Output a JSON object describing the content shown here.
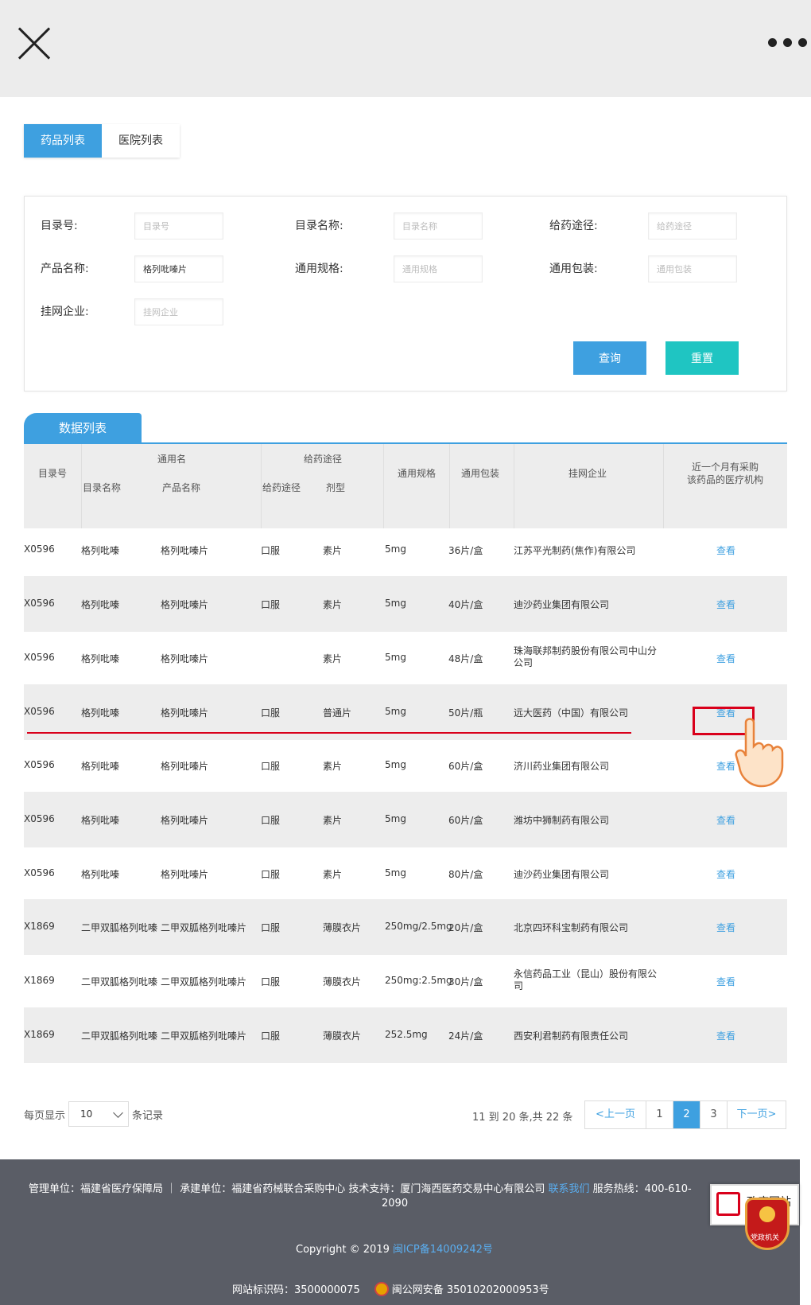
{
  "topbar": {
    "close_icon": "close-icon",
    "more_icon": "more-dots-icon"
  },
  "tabs": {
    "drug_list": "药品列表",
    "hospital_list": "医院列表"
  },
  "filter": {
    "catalog_no_label": "目录号:",
    "catalog_no_placeholder": "目录号",
    "catalog_name_label": "目录名称:",
    "catalog_name_placeholder": "目录名称",
    "route_label": "给药途径:",
    "route_placeholder": "给药途径",
    "product_name_label": "产品名称:",
    "product_name_value": "格列吡嗪片",
    "spec_label": "通用规格:",
    "spec_placeholder": "通用规格",
    "package_label": "通用包装:",
    "package_placeholder": "通用包装",
    "company_label": "挂网企业:",
    "company_placeholder": "挂网企业",
    "query_button": "查询",
    "reset_button": "重置"
  },
  "data_tab": "数据列表",
  "table": {
    "headers": {
      "catalog_no": "目录号",
      "generic_name": "通用名",
      "catalog_name": "目录名称",
      "product_name": "产品名称",
      "route_group": "给药途径",
      "route": "给药途径",
      "dosage_form": "剂型",
      "spec": "通用规格",
      "package": "通用包装",
      "company": "挂网企业",
      "recent_line1": "近一个月有采购",
      "recent_line2": "该药品的医疗机构"
    },
    "rows": [
      {
        "no": "X0596",
        "catalog": "格列吡嗪",
        "product": "格列吡嗪片",
        "route": "口服",
        "form": "素片",
        "spec": "5mg",
        "pack": "36片/盒",
        "company": "江苏平光制药(焦作)有限公司",
        "view": "查看"
      },
      {
        "no": "X0596",
        "catalog": "格列吡嗪",
        "product": "格列吡嗪片",
        "route": "口服",
        "form": "素片",
        "spec": "5mg",
        "pack": "40片/盒",
        "company": "迪沙药业集团有限公司",
        "view": "查看"
      },
      {
        "no": "X0596",
        "catalog": "格列吡嗪",
        "product": "格列吡嗪片",
        "route": "",
        "form": "素片",
        "spec": "5mg",
        "pack": "48片/盒",
        "company": "珠海联邦制药股份有限公司中山分公司",
        "view": "查看"
      },
      {
        "no": "X0596",
        "catalog": "格列吡嗪",
        "product": "格列吡嗪片",
        "route": "口服",
        "form": "普通片",
        "spec": "5mg",
        "pack": "50片/瓶",
        "company": "远大医药（中国）有限公司",
        "view": "查看"
      },
      {
        "no": "X0596",
        "catalog": "格列吡嗪",
        "product": "格列吡嗪片",
        "route": "口服",
        "form": "素片",
        "spec": "5mg",
        "pack": "60片/盒",
        "company": "济川药业集团有限公司",
        "view": "查看"
      },
      {
        "no": "X0596",
        "catalog": "格列吡嗪",
        "product": "格列吡嗪片",
        "route": "口服",
        "form": "素片",
        "spec": "5mg",
        "pack": "60片/盒",
        "company": "潍坊中狮制药有限公司",
        "view": "查看"
      },
      {
        "no": "X0596",
        "catalog": "格列吡嗪",
        "product": "格列吡嗪片",
        "route": "口服",
        "form": "素片",
        "spec": "5mg",
        "pack": "80片/盒",
        "company": "迪沙药业集团有限公司",
        "view": "查看"
      },
      {
        "no": "X1869",
        "catalog": "二甲双胍格列吡嗪",
        "product": "二甲双胍格列吡嗪片",
        "route": "口服",
        "form": "薄膜衣片",
        "spec": "250mg/2.5mg",
        "pack": "20片/盒",
        "company": "北京四环科宝制药有限公司",
        "view": "查看"
      },
      {
        "no": "X1869",
        "catalog": "二甲双胍格列吡嗪",
        "product": "二甲双胍格列吡嗪片",
        "route": "口服",
        "form": "薄膜衣片",
        "spec": "250mg:2.5mg",
        "pack": "30片/盒",
        "company": "永信药品工业（昆山）股份有限公司",
        "view": "查看"
      },
      {
        "no": "X1869",
        "catalog": "二甲双胍格列吡嗪",
        "product": "二甲双胍格列吡嗪片",
        "route": "口服",
        "form": "薄膜衣片",
        "spec": "252.5mg",
        "pack": "24片/盒",
        "company": "西安利君制药有限责任公司",
        "view": "查看"
      }
    ]
  },
  "pagination": {
    "per_page_label": "每页显示",
    "per_page_value": "10",
    "records_label": "条记录",
    "info": "11 到 20 条,共 22 条",
    "prev": "<上一页",
    "pages": [
      "1",
      "2",
      "3"
    ],
    "current": "2",
    "next": "下一页>"
  },
  "footer": {
    "line1": "管理单位：福建省医疗保障局 ｜ 承建单位：福建省药械联合采购中心   技术支持：厦门海西医药交易中心有限公司 ",
    "contact_link": "联系我们",
    "hotline_prefix": " 服务热线：400-610-",
    "hotline_suffix": "2090",
    "copyright": "Copyright © 2019 ",
    "icp": "闽ICP备14009242号",
    "site_id": "网站标识码：3500000075",
    "police": "闽公网安备 35010202000953号"
  },
  "gov_badge": {
    "text": "政府网站",
    "party_text": "党政机关"
  },
  "colors": {
    "accent": "#3ea0e0",
    "reset": "#1fc5c2",
    "highlight": "#d9001b",
    "footer_bg": "#5a5d66"
  }
}
